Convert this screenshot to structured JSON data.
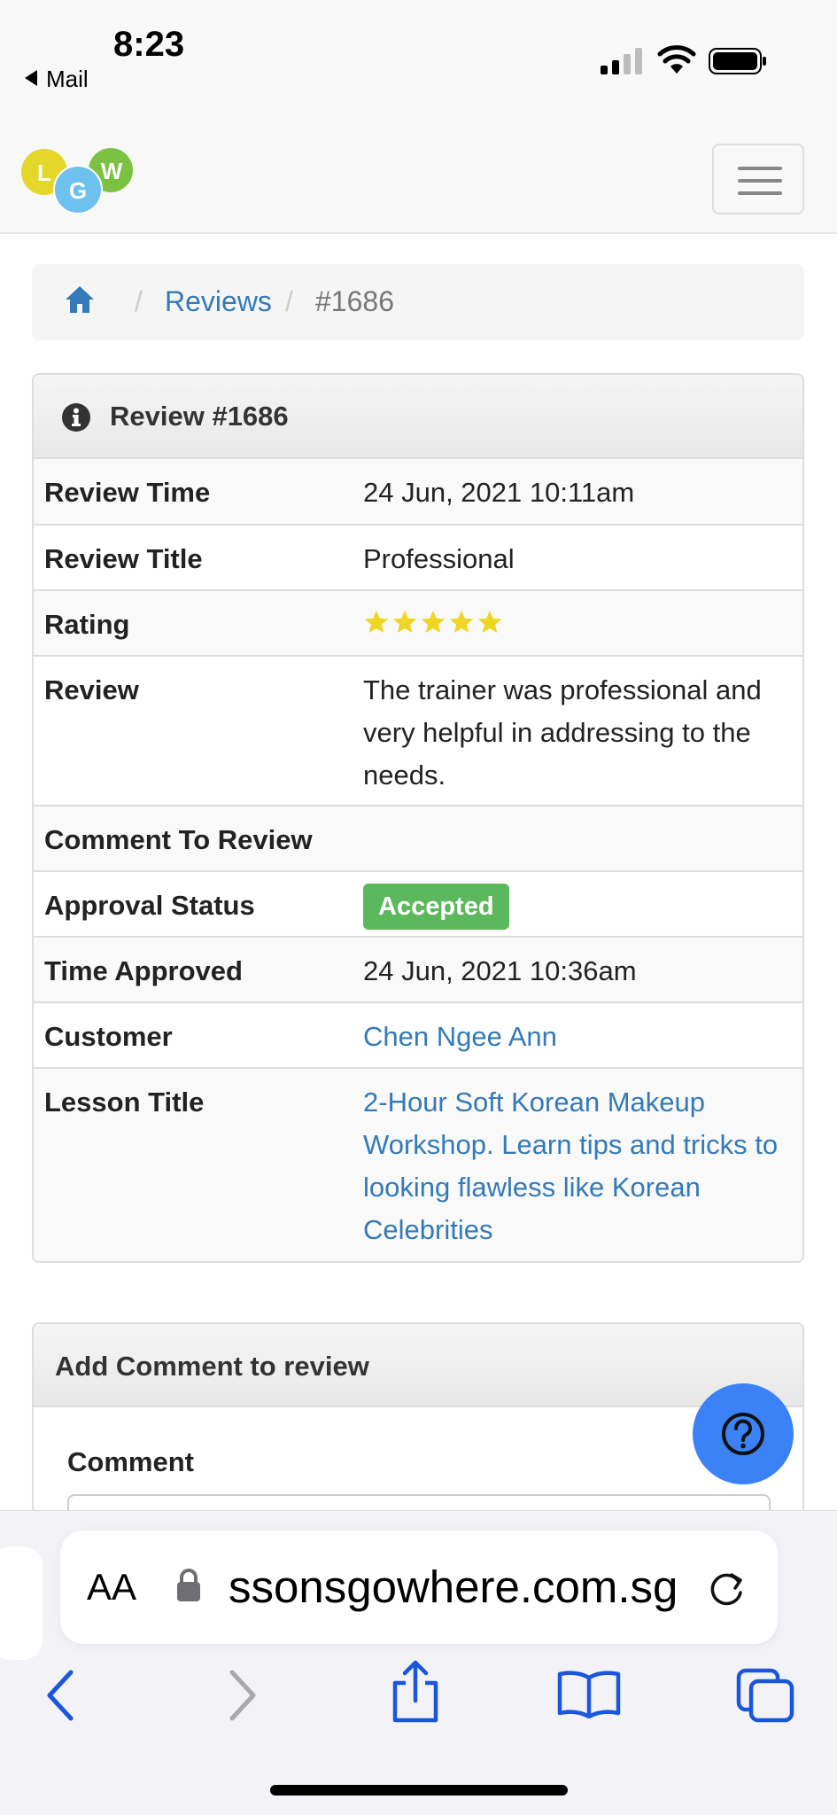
{
  "status_bar": {
    "time": "8:23",
    "back_label": "Mail"
  },
  "navbar": {
    "logo_letters": [
      "L",
      "G",
      "W"
    ]
  },
  "breadcrumb": {
    "items": [
      "Reviews",
      "#1686"
    ]
  },
  "review_panel": {
    "title": "Review #1686",
    "rows": {
      "review_time": {
        "label": "Review Time",
        "value": "24 Jun, 2021 10:11am"
      },
      "review_title": {
        "label": "Review Title",
        "value": "Professional"
      },
      "rating": {
        "label": "Rating",
        "stars": 5,
        "max_stars": 5
      },
      "review": {
        "label": "Review",
        "value": "The trainer was professional and very helpful in addressing to the needs."
      },
      "comment": {
        "label": "Comment To Review",
        "value": ""
      },
      "approval_status": {
        "label": "Approval Status",
        "value": "Accepted"
      },
      "time_approved": {
        "label": "Time Approved",
        "value": "24 Jun, 2021 10:36am"
      },
      "customer": {
        "label": "Customer",
        "value": "Chen Ngee Ann"
      },
      "lesson_title": {
        "label": "Lesson Title",
        "value": "2-Hour Soft Korean Makeup Workshop. Learn tips and tricks to looking flawless like Korean Celebrities"
      }
    }
  },
  "comment_panel": {
    "title": "Add Comment to review",
    "comment_label": "Comment"
  },
  "browser": {
    "aa_label": "AA",
    "url": "ssonsgowhere.com.sg"
  },
  "colors": {
    "link": "#337ab7",
    "success": "#5cb85c",
    "star": "#f0d624",
    "help_button": "#3b82f6",
    "ios_blue": "#1a56db"
  }
}
